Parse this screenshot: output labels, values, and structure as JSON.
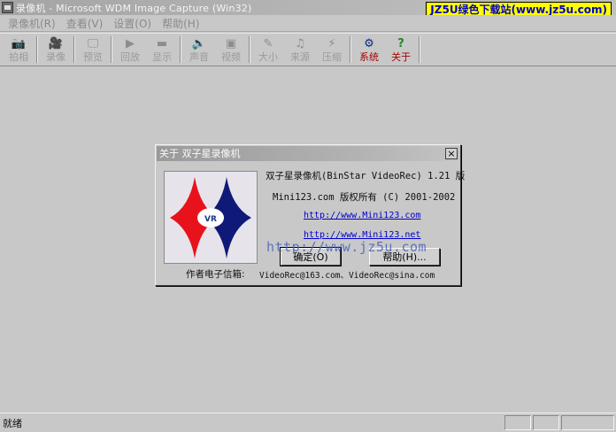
{
  "window": {
    "title": "录像机 - Microsoft WDM Image Capture (Win32)",
    "watermark": "JZ5U绿色下载站(www.jz5u.com)"
  },
  "menu": [
    {
      "label": "录像机(R)"
    },
    {
      "label": "查看(V)"
    },
    {
      "label": "设置(O)"
    },
    {
      "label": "帮助(H)"
    }
  ],
  "toolbar": [
    {
      "label": "拍相",
      "icon": "camera-icon",
      "glyph": "📷",
      "state": "disabled"
    },
    {
      "label": "录像",
      "icon": "record-icon",
      "glyph": "🎥",
      "state": "disabled"
    },
    {
      "label": "预览",
      "icon": "preview-icon",
      "glyph": "🖵",
      "state": "disabled"
    },
    {
      "label": "回放",
      "icon": "play-icon",
      "glyph": "▶",
      "state": "disabled"
    },
    {
      "label": "显示",
      "icon": "display-icon",
      "glyph": "▬",
      "state": "disabled"
    },
    {
      "label": "声音",
      "icon": "speaker-icon",
      "glyph": "🔈",
      "state": "disabled"
    },
    {
      "label": "视频",
      "icon": "video-icon",
      "glyph": "▣",
      "state": "disabled"
    },
    {
      "label": "大小",
      "icon": "size-icon",
      "glyph": "✎",
      "state": "disabled"
    },
    {
      "label": "来源",
      "icon": "source-icon",
      "glyph": "♫",
      "state": "disabled"
    },
    {
      "label": "压缩",
      "icon": "compress-icon",
      "glyph": "⚡",
      "state": "disabled"
    },
    {
      "label": "系统",
      "icon": "system-icon",
      "glyph": "⚙",
      "state": "active"
    },
    {
      "label": "关于",
      "icon": "help-question-icon",
      "glyph": "?",
      "state": "help"
    }
  ],
  "about_dialog": {
    "title": "关于 双子星录像机",
    "close_glyph": "×",
    "product": "双子星录像机(BinStar VideoRec) 1.21 版",
    "copyright": "Mini123.com 版权所有 (C) 2001-2002",
    "link1": "http://www.Mini123.com",
    "link2": "http://www.Mini123.net",
    "ok_label": "确定(O)",
    "help_label": "帮助(H)...",
    "email_label": "作者电子信箱:",
    "email_value": "VideoRec@163.com、VideoRec@sina.com",
    "logo_text": "VR",
    "colors": {
      "left_star": "#e8121c",
      "right_star": "#0f1a78"
    }
  },
  "overlay_watermark": "http://www.jz5u.com",
  "status": {
    "text": "就绪"
  }
}
